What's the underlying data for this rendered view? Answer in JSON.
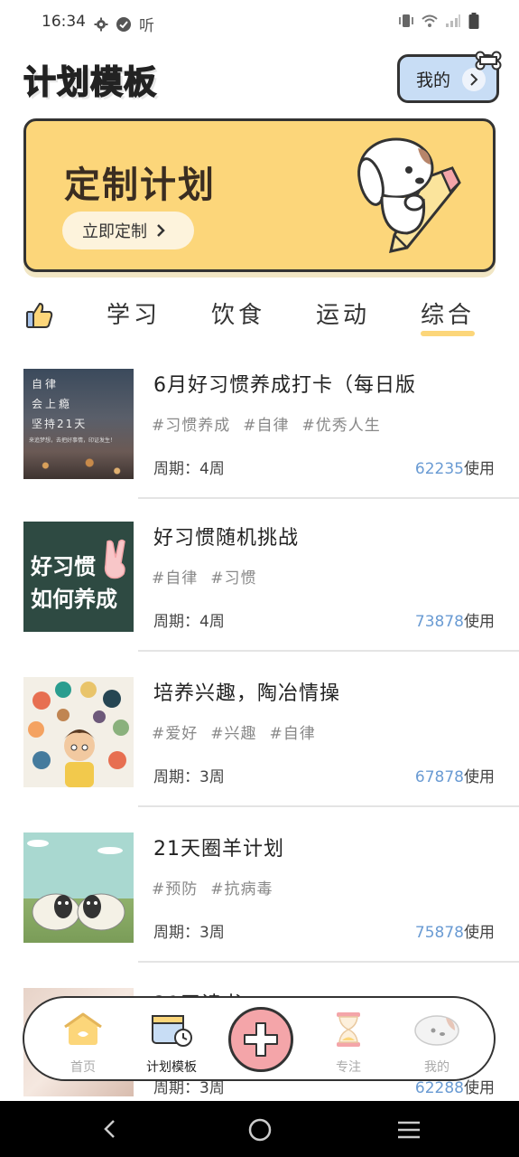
{
  "status_bar": {
    "time": "16:34",
    "left_icons": [
      "gear-icon",
      "check-circle-icon",
      "ting-icon"
    ],
    "ting_text": "听",
    "right_icons": [
      "vibrate-icon",
      "wifi-icon",
      "signal-icon",
      "battery-icon"
    ]
  },
  "header": {
    "title": "计划模板",
    "mine_button_label": "我的"
  },
  "banner": {
    "title": "定制计划",
    "button_label": "立即定制",
    "background_color": "#fcd67a"
  },
  "tabs": [
    {
      "label": "学习",
      "active": false
    },
    {
      "label": "饮食",
      "active": false
    },
    {
      "label": "运动",
      "active": false
    },
    {
      "label": "综合",
      "active": true
    }
  ],
  "plans": [
    {
      "title": "6月好习惯养成打卡（每日版",
      "tags": [
        "#习惯养成",
        "#自律",
        "#优秀人生"
      ],
      "period": "周期：4周",
      "usage_count": "62235",
      "usage_suffix": "使用",
      "thumb_text": [
        "自律",
        "会上瘾",
        "坚持21天",
        "来追梦想，去把好事情，印证发生！"
      ]
    },
    {
      "title": "好习惯随机挑战",
      "tags": [
        "#自律",
        "#习惯"
      ],
      "period": "周期：4周",
      "usage_count": "73878",
      "usage_suffix": "使用",
      "thumb_text": [
        "好习惯",
        "如何养成"
      ]
    },
    {
      "title": "培养兴趣，陶冶情操",
      "tags": [
        "#爱好",
        "#兴趣",
        "#自律"
      ],
      "period": "周期：3周",
      "usage_count": "67878",
      "usage_suffix": "使用"
    },
    {
      "title": "21天圈羊计划",
      "tags": [
        "#预防",
        "#抗病毒"
      ],
      "period": "周期：3周",
      "usage_count": "75878",
      "usage_suffix": "使用"
    },
    {
      "title": "21天读书",
      "tags": [],
      "period": "周期：3周",
      "usage_count": "62288",
      "usage_suffix": "使用"
    }
  ],
  "bottom_nav": [
    {
      "label": "首页",
      "icon": "home-icon",
      "active": false
    },
    {
      "label": "计划模板",
      "icon": "calendar-icon",
      "active": true
    },
    {
      "label": "",
      "icon": "add-icon",
      "active": false
    },
    {
      "label": "专注",
      "icon": "hourglass-icon",
      "active": false
    },
    {
      "label": "我的",
      "icon": "dog-profile-icon",
      "active": false
    }
  ]
}
